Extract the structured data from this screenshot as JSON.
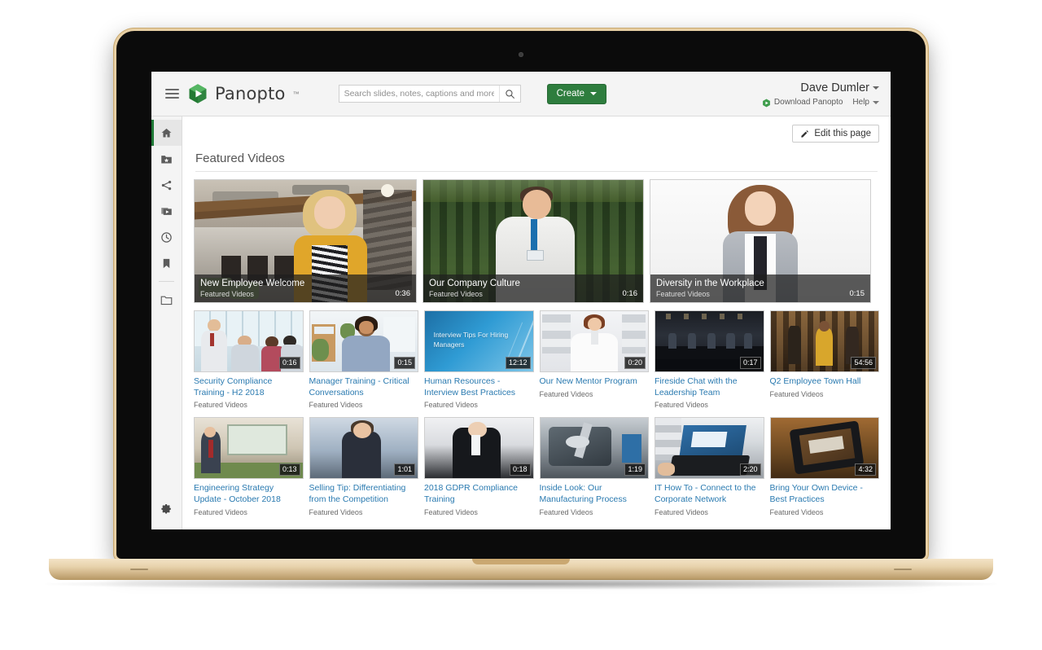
{
  "app": {
    "brand_name": "Panopto",
    "brand_tm": "™"
  },
  "topbar": {
    "menu_icon": "hamburger-icon",
    "search": {
      "placeholder": "Search slides, notes, captions and more",
      "value": "",
      "icon": "search-icon"
    },
    "create_label": "Create",
    "account_name": "Dave Dumler",
    "download_label": "Download Panopto",
    "help_label": "Help",
    "accent_green": "#2e7d3e"
  },
  "sidebar": {
    "items": [
      {
        "name": "home",
        "icon": "home-icon",
        "active": true
      },
      {
        "name": "my-folder",
        "icon": "folder-star-icon",
        "active": false
      },
      {
        "name": "shared-with-me",
        "icon": "share-icon",
        "active": false
      },
      {
        "name": "my-videos",
        "icon": "video-stack-icon",
        "active": false
      },
      {
        "name": "recent",
        "icon": "clock-icon",
        "active": false
      },
      {
        "name": "bookmarks",
        "icon": "bookmark-icon",
        "active": false
      },
      {
        "name": "browse-folders",
        "icon": "folder-icon",
        "active": false
      }
    ],
    "settings": {
      "name": "settings",
      "icon": "gear-icon"
    }
  },
  "content": {
    "edit_page_label": "Edit this page",
    "edit_page_icon": "pencil-icon",
    "section_title": "Featured Videos",
    "link_color": "#2a7ab0"
  },
  "featured": [
    {
      "title": "New Employee Welcome",
      "folder": "Featured Videos",
      "duration": "0:36",
      "thumb": "office-woman-welcome"
    },
    {
      "title": "Our Company Culture",
      "folder": "Featured Videos",
      "duration": "0:16",
      "thumb": "outdoor-man-interview"
    },
    {
      "title": "Diversity in the Workplace",
      "folder": "Featured Videos",
      "duration": "0:15",
      "thumb": "studio-woman-portrait"
    }
  ],
  "videos": [
    {
      "title": "Security Compliance Training - H2 2018",
      "folder": "Featured Videos",
      "duration": "0:16",
      "thumb": "meeting-room-group"
    },
    {
      "title": "Manager Training - Critical Conversations",
      "folder": "Featured Videos",
      "duration": "0:15",
      "thumb": "office-woman-desk"
    },
    {
      "title": "Human Resources - Interview Best Practices",
      "folder": "Featured Videos",
      "duration": "12:12",
      "thumb": "blue-slide",
      "slide_text": "Interview Tips For Hiring Managers"
    },
    {
      "title": "Our New Mentor Program",
      "folder": "Featured Videos",
      "duration": "0:20",
      "thumb": "office-woman-shelves"
    },
    {
      "title": "Fireside Chat with the Leadership Team",
      "folder": "Featured Videos",
      "duration": "0:17",
      "thumb": "stage-panel"
    },
    {
      "title": "Q2 Employee Town Hall",
      "folder": "Featured Videos",
      "duration": "54:56",
      "thumb": "auditorium-crowd"
    },
    {
      "title": "Engineering Strategy Update - October 2018",
      "folder": "Featured Videos",
      "duration": "0:13",
      "thumb": "presenter-whiteboard"
    },
    {
      "title": "Selling Tip: Differentiating from the Competition",
      "folder": "Featured Videos",
      "duration": "1:01",
      "thumb": "woman-glasses-speaking"
    },
    {
      "title": "2018 GDPR Compliance Training",
      "folder": "Featured Videos",
      "duration": "0:18",
      "thumb": "woman-dark-suit"
    },
    {
      "title": "Inside Look: Our Manufacturing Process",
      "folder": "Featured Videos",
      "duration": "1:19",
      "thumb": "factory-machine"
    },
    {
      "title": "IT How To - Connect to the Corporate Network",
      "folder": "Featured Videos",
      "duration": "2:20",
      "thumb": "laptop-hands"
    },
    {
      "title": "Bring Your Own Device - Best Practices",
      "folder": "Featured Videos",
      "duration": "4:32",
      "thumb": "tablet-on-desk"
    }
  ]
}
